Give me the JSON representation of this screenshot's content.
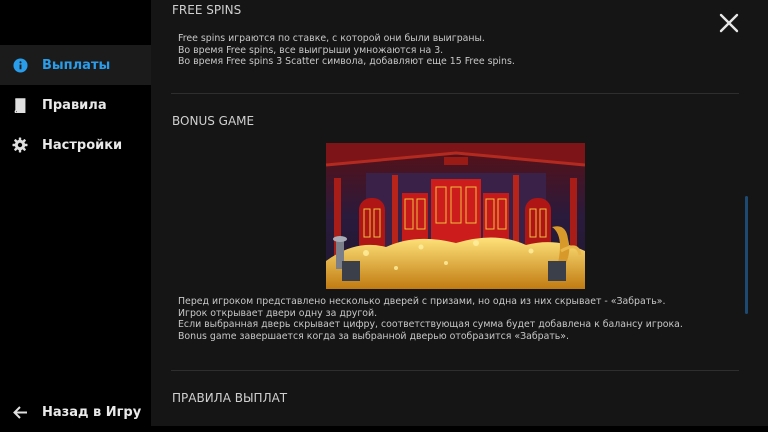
{
  "sidebar": {
    "items": [
      {
        "label": "Выплаты",
        "icon": "info-icon"
      },
      {
        "label": "Правила",
        "icon": "book-icon"
      },
      {
        "label": "Настройки",
        "icon": "gear-icon"
      }
    ],
    "back_label": "Назад в Игру",
    "back_icon": "arrow-left-icon"
  },
  "sections": {
    "free_spins": {
      "title": "FREE SPINS",
      "lines": [
        "Free spins играются по ставке, с которой они были выиграны.",
        "Во время Free spins, все выигрыши умножаются на 3.",
        "Во время Free spins 3 Scatter символа, добавляют еще 15 Free spins."
      ]
    },
    "bonus_game": {
      "title": "BONUS GAME",
      "lines": [
        "Перед игроком представлено несколько дверей с призами, но одна из них скрывает - «Забрать».",
        "Игрок открывает двери одну за другой.",
        "Если выбранная дверь скрывает цифру, соответствующая сумма будет добавлена к балансу игрока.",
        "Bonus game завершается когда за выбранной дверью отобразится «Забрать»."
      ]
    },
    "payout_rules": {
      "title": "ПРАВИЛА ВЫПЛАТ"
    }
  },
  "colors": {
    "accent": "#2a9dea",
    "background": "#151515",
    "sidebar": "#000000"
  }
}
